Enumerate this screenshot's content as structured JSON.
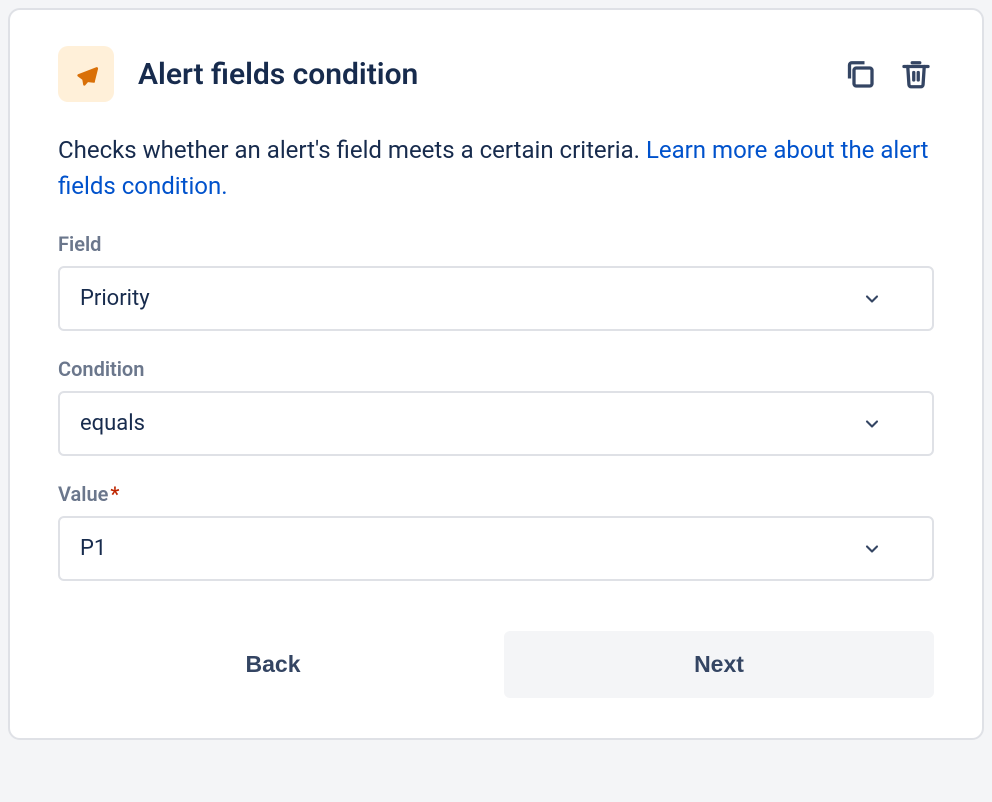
{
  "header": {
    "title": "Alert fields condition",
    "icon": "bell-alert-icon",
    "actions": {
      "duplicate": "duplicate-icon",
      "delete": "trash-icon"
    }
  },
  "description": {
    "text": "Checks whether an alert's field meets a certain criteria. ",
    "link_text": "Learn more about the alert fields condition."
  },
  "fields": {
    "field": {
      "label": "Field",
      "value": "Priority"
    },
    "condition": {
      "label": "Condition",
      "value": "equals"
    },
    "value_field": {
      "label": "Value",
      "required_marker": "*",
      "value": "P1"
    }
  },
  "footer": {
    "back": "Back",
    "next": "Next"
  }
}
